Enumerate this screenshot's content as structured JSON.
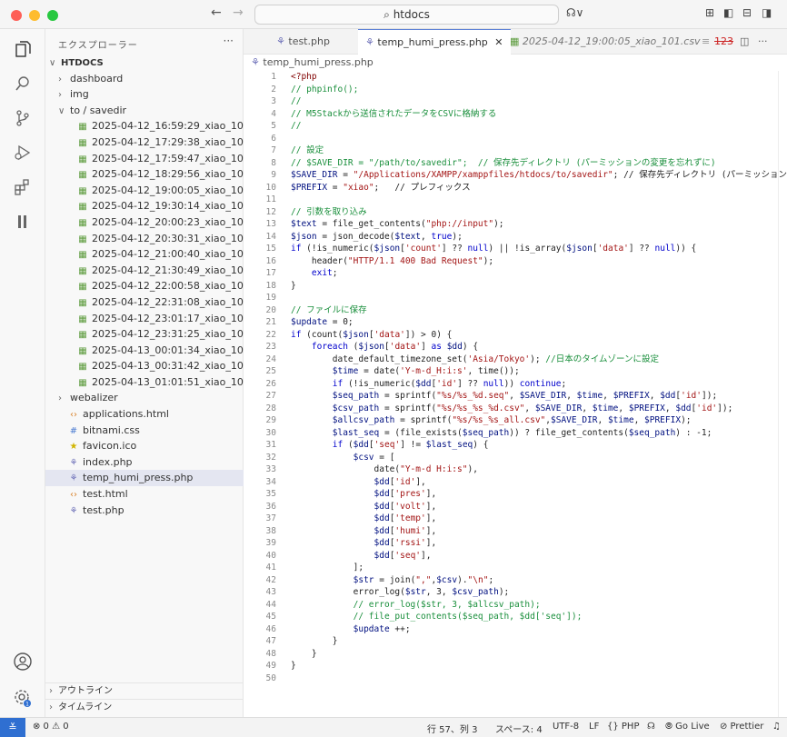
{
  "titlebar": {
    "back": "←",
    "forward": "→",
    "search": "htdocs",
    "copilot": "☊∨"
  },
  "explorer": {
    "title": "エクスプローラー",
    "more": "···",
    "rows": [
      {
        "indent": 0,
        "chev": "∨",
        "icon": "",
        "label": "HTDOCS",
        "type": "root"
      },
      {
        "indent": 1,
        "chev": "›",
        "icon": "",
        "label": "dashboard",
        "type": "folder"
      },
      {
        "indent": 1,
        "chev": "›",
        "icon": "",
        "label": "img",
        "type": "folder"
      },
      {
        "indent": 1,
        "chev": "∨",
        "icon": "",
        "label": "to / savedir",
        "type": "folder"
      },
      {
        "indent": 2,
        "chev": "",
        "icon": "▦",
        "label": "2025-04-12_16:59:29_xiao_101.csv",
        "type": "csv"
      },
      {
        "indent": 2,
        "chev": "",
        "icon": "▦",
        "label": "2025-04-12_17:29:38_xiao_101.csv",
        "type": "csv"
      },
      {
        "indent": 2,
        "chev": "",
        "icon": "▦",
        "label": "2025-04-12_17:59:47_xiao_101.csv",
        "type": "csv"
      },
      {
        "indent": 2,
        "chev": "",
        "icon": "▦",
        "label": "2025-04-12_18:29:56_xiao_101.csv",
        "type": "csv"
      },
      {
        "indent": 2,
        "chev": "",
        "icon": "▦",
        "label": "2025-04-12_19:00:05_xiao_101.csv",
        "type": "csv"
      },
      {
        "indent": 2,
        "chev": "",
        "icon": "▦",
        "label": "2025-04-12_19:30:14_xiao_101.csv",
        "type": "csv"
      },
      {
        "indent": 2,
        "chev": "",
        "icon": "▦",
        "label": "2025-04-12_20:00:23_xiao_101.csv",
        "type": "csv"
      },
      {
        "indent": 2,
        "chev": "",
        "icon": "▦",
        "label": "2025-04-12_20:30:31_xiao_101.csv",
        "type": "csv"
      },
      {
        "indent": 2,
        "chev": "",
        "icon": "▦",
        "label": "2025-04-12_21:00:40_xiao_101.csv",
        "type": "csv"
      },
      {
        "indent": 2,
        "chev": "",
        "icon": "▦",
        "label": "2025-04-12_21:30:49_xiao_101.csv",
        "type": "csv"
      },
      {
        "indent": 2,
        "chev": "",
        "icon": "▦",
        "label": "2025-04-12_22:00:58_xiao_101.csv",
        "type": "csv"
      },
      {
        "indent": 2,
        "chev": "",
        "icon": "▦",
        "label": "2025-04-12_22:31:08_xiao_101.csv",
        "type": "csv"
      },
      {
        "indent": 2,
        "chev": "",
        "icon": "▦",
        "label": "2025-04-12_23:01:17_xiao_101.csv",
        "type": "csv"
      },
      {
        "indent": 2,
        "chev": "",
        "icon": "▦",
        "label": "2025-04-12_23:31:25_xiao_101.csv",
        "type": "csv"
      },
      {
        "indent": 2,
        "chev": "",
        "icon": "▦",
        "label": "2025-04-13_00:01:34_xiao_101.csv",
        "type": "csv"
      },
      {
        "indent": 2,
        "chev": "",
        "icon": "▦",
        "label": "2025-04-13_00:31:42_xiao_101.csv",
        "type": "csv"
      },
      {
        "indent": 2,
        "chev": "",
        "icon": "▦",
        "label": "2025-04-13_01:01:51_xiao_101.csv",
        "type": "csv"
      },
      {
        "indent": 1,
        "chev": "›",
        "icon": "",
        "label": "webalizer",
        "type": "folder"
      },
      {
        "indent": 1,
        "chev": "",
        "icon": "‹›",
        "label": "applications.html",
        "type": "html"
      },
      {
        "indent": 1,
        "chev": "",
        "icon": "#",
        "label": "bitnami.css",
        "type": "css"
      },
      {
        "indent": 1,
        "chev": "",
        "icon": "★",
        "label": "favicon.ico",
        "type": "ico"
      },
      {
        "indent": 1,
        "chev": "",
        "icon": "⚘",
        "label": "index.php",
        "type": "php"
      },
      {
        "indent": 1,
        "chev": "",
        "icon": "⚘",
        "label": "temp_humi_press.php",
        "type": "php",
        "selected": true
      },
      {
        "indent": 1,
        "chev": "",
        "icon": "‹›",
        "label": "test.html",
        "type": "html"
      },
      {
        "indent": 1,
        "chev": "",
        "icon": "⚘",
        "label": "test.php",
        "type": "php"
      }
    ],
    "outline": "アウトライン",
    "timeline": "タイムライン"
  },
  "tabs": [
    {
      "label": "test.php",
      "icon": "⚘",
      "active": false
    },
    {
      "label": "temp_humi_press.php",
      "icon": "⚘",
      "active": true,
      "close": "✕"
    },
    {
      "label": "2025-04-12_19:00:05_xiao_101.csv",
      "icon": "▦",
      "active": false
    }
  ],
  "tab_actions": {
    "open_changes": "≡",
    "line_count": "123",
    "split": "◫",
    "more": "···"
  },
  "breadcrumb": "temp_humi_press.php",
  "code": [
    "<?php",
    "// phpinfo();",
    "//",
    "// M5Stackから送信されたデータをCSVに格納する",
    "//",
    "",
    "// 設定",
    "// $SAVE_DIR = \"/path/to/savedir\";  // 保存先ディレクトリ (パーミッションの変更を忘れずに)",
    "$SAVE_DIR = \"/Applications/XAMPP/xamppfiles/htdocs/to/savedir\"; // 保存先ディレクトリ (パーミッション",
    "$PREFIX = \"xiao\";   // プレフィックス",
    "",
    "// 引数を取り込み",
    "$text = file_get_contents(\"php://input\");",
    "$json = json_decode($text, true);",
    "if (!is_numeric($json['count'] ?? null) || !is_array($json['data'] ?? null)) {",
    "    header(\"HTTP/1.1 400 Bad Request\");",
    "    exit;",
    "}",
    "",
    "// ファイルに保存",
    "$update = 0;",
    "if (count($json['data']) > 0) {",
    "    foreach ($json['data'] as $dd) {",
    "        date_default_timezone_set('Asia/Tokyo'); //日本のタイムゾーンに設定",
    "        $time = date('Y-m-d_H:i:s', time());",
    "        if (!is_numeric($dd['id'] ?? null)) continue;",
    "        $seq_path = sprintf(\"%s/%s_%d.seq\", $SAVE_DIR, $time, $PREFIX, $dd['id']);",
    "        $csv_path = sprintf(\"%s/%s_%s_%d.csv\", $SAVE_DIR, $time, $PREFIX, $dd['id']);",
    "        $allcsv_path = sprintf(\"%s/%s_%s_all.csv\",$SAVE_DIR, $time, $PREFIX);",
    "        $last_seq = (file_exists($seq_path)) ? file_get_contents($seq_path) : -1;",
    "        if ($dd['seq'] != $last_seq) {",
    "            $csv = [",
    "                date(\"Y-m-d H:i:s\"),",
    "                $dd['id'],",
    "                $dd['pres'],",
    "                $dd['volt'],",
    "                $dd['temp'],",
    "                $dd['humi'],",
    "                $dd['rssi'],",
    "                $dd['seq'],",
    "            ];",
    "            $str = join(\",\",$csv).\"\\n\";",
    "            error_log($str, 3, $csv_path);",
    "            // error_log($str, 3, $allcsv_path);",
    "            // file_put_contents($seq_path, $dd['seq']);",
    "            $update ++;",
    "        }",
    "    }",
    "}",
    ""
  ],
  "line_numbers_start": 1,
  "status": {
    "remote": "≚",
    "problems": "⊗ 0 ⚠ 0",
    "position": "行 57、列 3",
    "spaces": "スペース: 4",
    "encoding": "UTF-8",
    "eol": "LF",
    "language": "{} PHP",
    "copilot": "☊",
    "golive": "⦾ Go Live",
    "prettier": "⊘ Prettier",
    "bell": "♫"
  },
  "colors": {
    "accent": "#2f6fd1",
    "comment": "#1a8f3c",
    "keyword": "#0000cc",
    "string": "#a31515",
    "variable": "#001080",
    "php_icon": "#6c6fb8",
    "csv_icon": "#5a9a3a"
  }
}
